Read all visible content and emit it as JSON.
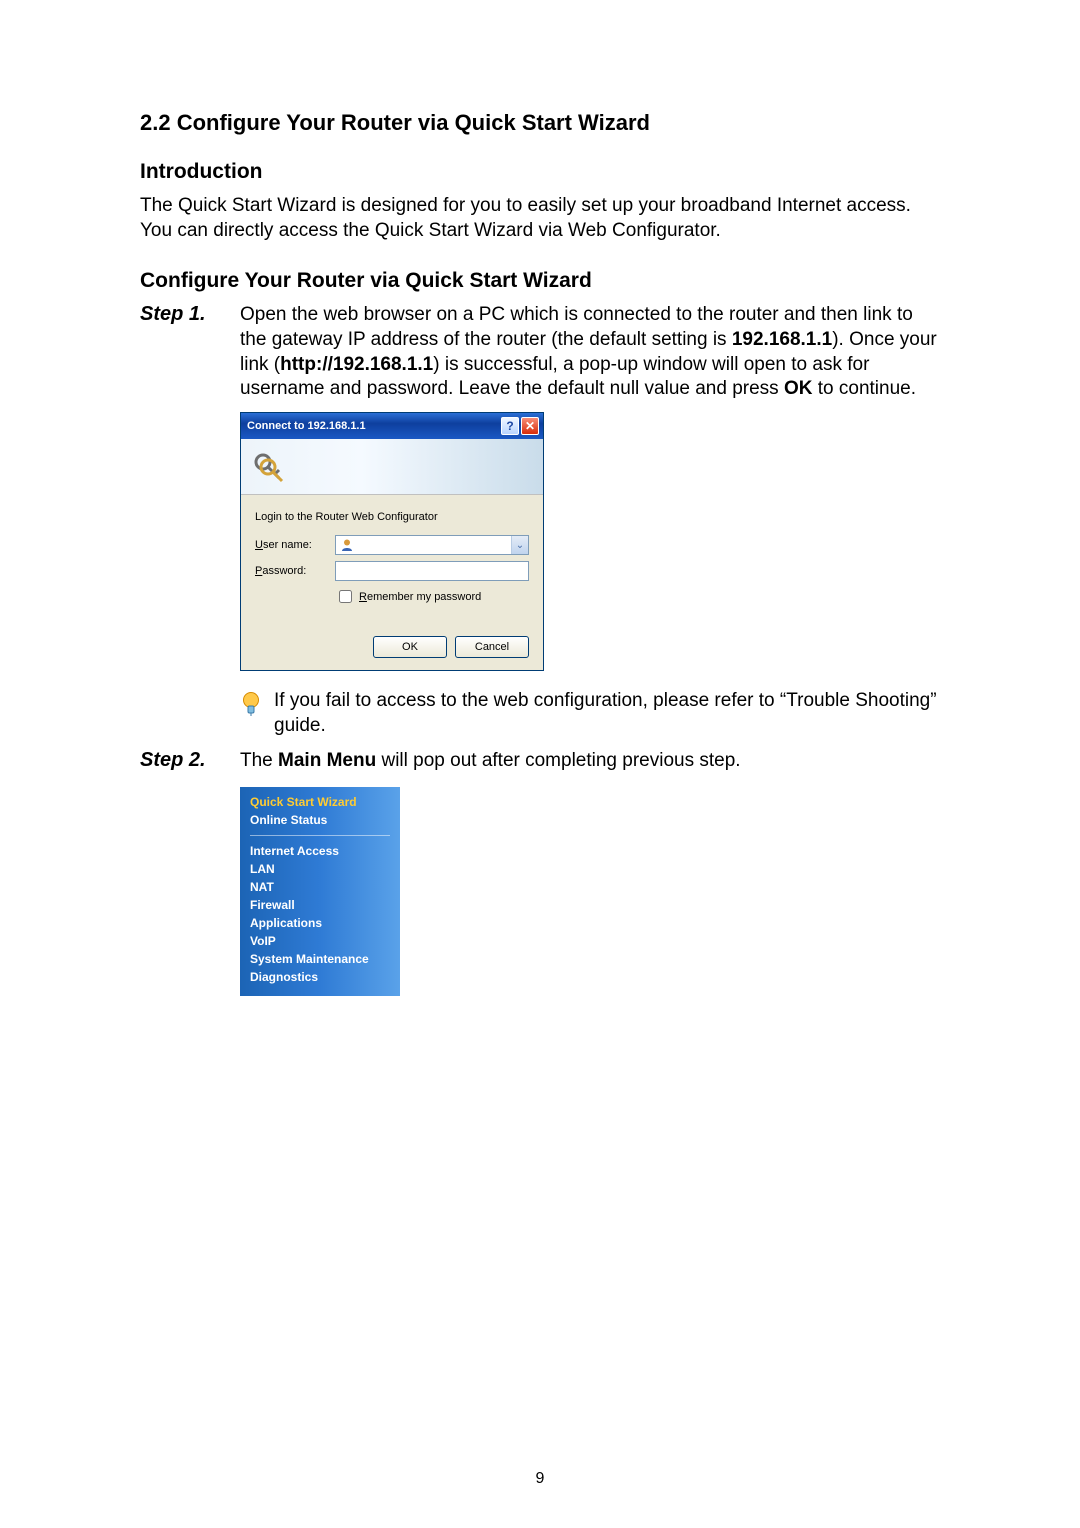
{
  "section_title": "2.2 Configure Your Router via Quick Start Wizard",
  "intro_heading": "Introduction",
  "intro_text": "The Quick Start Wizard is designed for you to easily set up your broadband Internet access.    You can directly access the Quick Start Wizard via Web Configurator.",
  "second_heading": "Configure Your Router via Quick Start Wizard",
  "step1": {
    "label": "Step 1.",
    "pre1": "Open the web browser on a PC which is connected to the router and then link to the gateway IP address of the router (the default setting is ",
    "ip1": "192.168.1.1",
    "mid1": "). Once your link (",
    "url": "http://192.168.1.1",
    "mid2": ") is successful, a pop-up window will open to ask for username and password. Leave the default null value and press ",
    "ok_bold": "OK",
    "tail": " to continue."
  },
  "dialog": {
    "title": "Connect to 192.168.1.1",
    "help_glyph": "?",
    "close_glyph": "✕",
    "prompt": "Login to the Router Web Configurator",
    "username_label_u": "U",
    "username_label_rest": "ser name:",
    "password_label_p": "P",
    "password_label_rest": "assword:",
    "remember_r": "R",
    "remember_rest": "emember my password",
    "ok": "OK",
    "cancel": "Cancel",
    "chevron": "⌄"
  },
  "tip_text": "If you fail to access to the web configuration, please refer to “Trouble Shooting” guide.",
  "step2": {
    "label": "Step 2.",
    "pre": "The ",
    "bold": "Main Menu",
    "post": " will pop out after completing previous step."
  },
  "menu": {
    "top": [
      "Quick Start Wizard",
      "Online Status"
    ],
    "bottom": [
      "Internet Access",
      "LAN",
      "NAT",
      "Firewall",
      "Applications",
      "VoIP",
      "System Maintenance",
      "Diagnostics"
    ]
  },
  "page_number": "9"
}
